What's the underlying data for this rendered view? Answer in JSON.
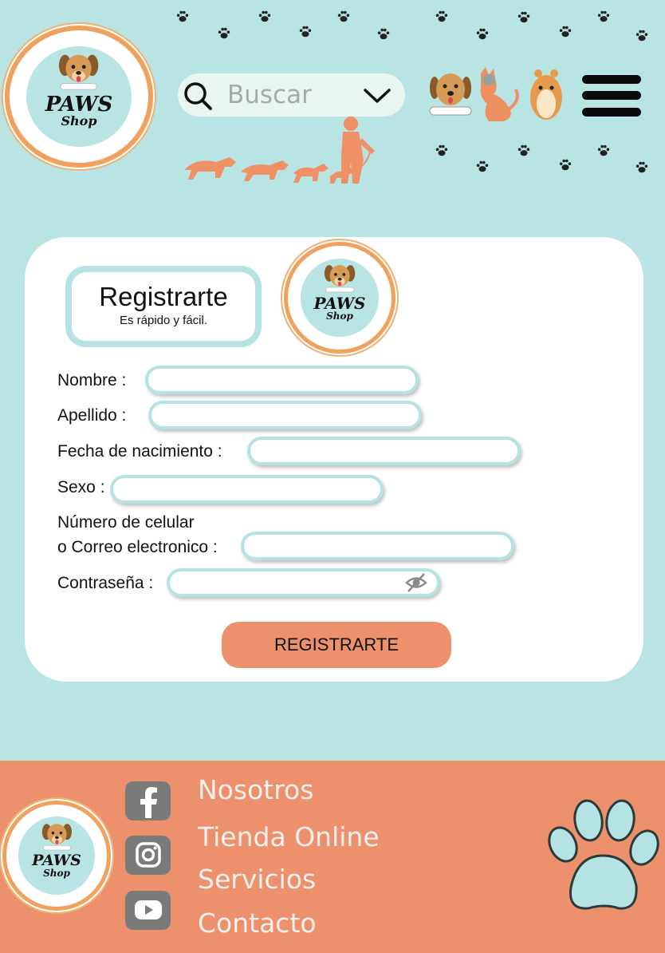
{
  "header": {
    "logo": {
      "line1": "PAWS",
      "line2": "Shop"
    },
    "search": {
      "placeholder": "Buscar"
    }
  },
  "form": {
    "title": "Registrarte",
    "subtitle": "Es rápido y fácil.",
    "fields": {
      "nombre": {
        "label": "Nombre :",
        "value": ""
      },
      "apellido": {
        "label": "Apellido :",
        "value": ""
      },
      "fecha": {
        "label": "Fecha de nacimiento :",
        "value": ""
      },
      "sexo": {
        "label": "Sexo :",
        "value": ""
      },
      "contacto": {
        "label_line1": "Número de celular",
        "label_line2": "o Correo electronico :",
        "value": ""
      },
      "password": {
        "label": "Contraseña :",
        "value": ""
      }
    },
    "submit_label": "REGISTRARTE"
  },
  "footer": {
    "links": [
      "Nosotros",
      "Tienda Online",
      "Servicios",
      "Contacto"
    ],
    "social": [
      "facebook-icon",
      "instagram-icon",
      "youtube-icon"
    ]
  },
  "colors": {
    "background": "#b9e4e4",
    "accent": "#ed916d",
    "field_border": "#b5e3e4",
    "logo_ring": "#f0a15d"
  }
}
